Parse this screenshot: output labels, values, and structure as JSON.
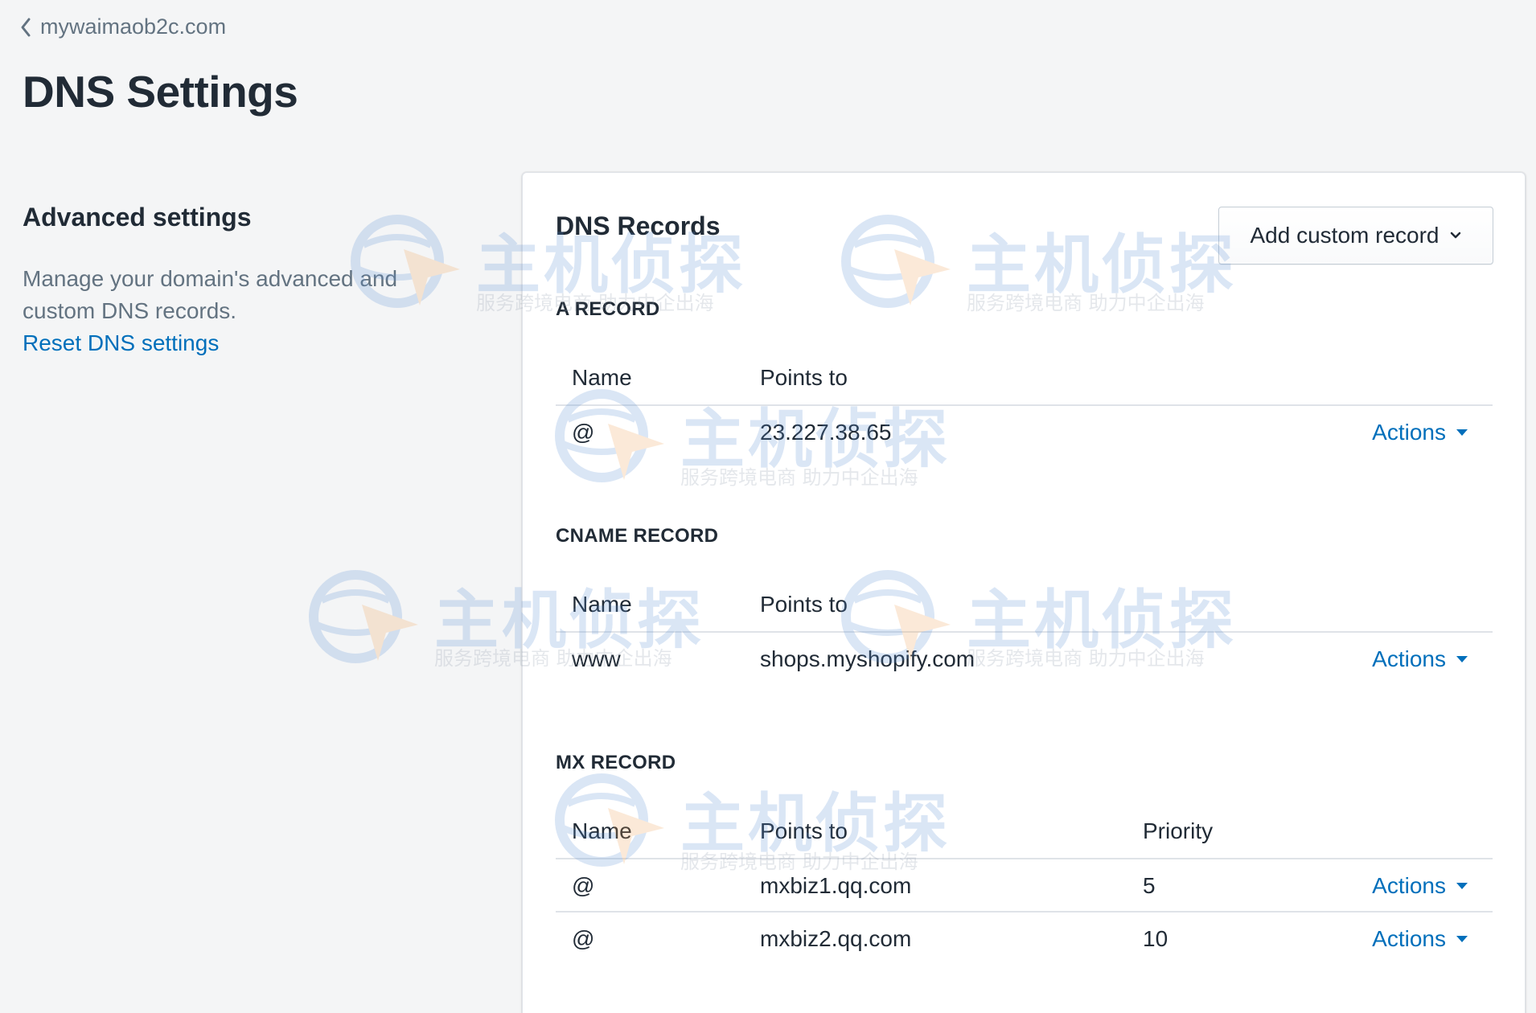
{
  "breadcrumb": {
    "label": "mywaimaob2c.com"
  },
  "page": {
    "title": "DNS Settings"
  },
  "aside": {
    "heading": "Advanced settings",
    "description": "Manage your domain's advanced and custom DNS records.",
    "reset_link": "Reset DNS settings"
  },
  "card": {
    "title": "DNS Records",
    "add_button": "Add custom record",
    "columns": {
      "name": "Name",
      "points_to": "Points to",
      "priority": "Priority"
    },
    "actions_label": "Actions",
    "a_record": {
      "label": "A RECORD",
      "rows": [
        {
          "name": "@",
          "points_to": "23.227.38.65"
        }
      ]
    },
    "cname_record": {
      "label": "CNAME RECORD",
      "rows": [
        {
          "name": "www",
          "points_to": "shops.myshopify.com"
        }
      ]
    },
    "mx_record": {
      "label": "MX RECORD",
      "rows": [
        {
          "name": "@",
          "points_to": "mxbiz1.qq.com",
          "priority": "5"
        },
        {
          "name": "@",
          "points_to": "mxbiz2.qq.com",
          "priority": "10"
        }
      ]
    }
  },
  "watermark": {
    "brand": "主机侦探",
    "tagline": "服务跨境电商 助力中企出海"
  },
  "colors": {
    "link": "#006fbb",
    "text": "#212b36",
    "muted": "#637381",
    "background": "#f4f5f6",
    "border": "#dfe3e8"
  }
}
